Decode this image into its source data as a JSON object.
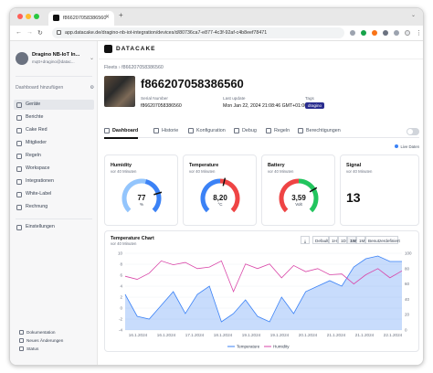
{
  "browser": {
    "tab_title": "f866207058386560",
    "url": "app.datacake.de/dragino-nb-iot-integration/devices/d/80736ca7-e877-4c3f-92af-c4b8eef78471"
  },
  "sidebar": {
    "workspace_name": "Dragino NB-IoT In...",
    "workspace_email": "mqtt+dragino@datac...",
    "add_dashboard": "Dashboard hinzufügen",
    "items": [
      {
        "label": "Geräte"
      },
      {
        "label": "Berichte"
      },
      {
        "label": "Cake Red"
      },
      {
        "label": "Mitglieder"
      },
      {
        "label": "Regeln"
      },
      {
        "label": "Workspace"
      },
      {
        "label": "Integrationen"
      },
      {
        "label": "White-Label"
      },
      {
        "label": "Rechnung"
      },
      {
        "label": "Einstellungen"
      }
    ],
    "footer": [
      {
        "label": "Dokumentation"
      },
      {
        "label": "Neues Änderungen"
      },
      {
        "label": "Status"
      }
    ]
  },
  "header": {
    "brand": "DATACAKE",
    "breadcrumb_root": "Fleets",
    "breadcrumb_current": "f866207058386560",
    "device_title": "f866207058386560",
    "serial_label": "Serial Number",
    "serial_value": "f866207058386560",
    "update_label": "Last update",
    "update_value": "Mon Jan 22, 2024 21:08:46 GMT+01:00",
    "tags_label": "Tags",
    "tag_value": "dragino"
  },
  "tabs": [
    {
      "label": "Dashboard"
    },
    {
      "label": "Historie"
    },
    {
      "label": "Konfiguration"
    },
    {
      "label": "Debug"
    },
    {
      "label": "Regeln"
    },
    {
      "label": "Berechtigungen"
    }
  ],
  "live_label": "Live Daten",
  "widgets": [
    {
      "title": "Humidity",
      "subtitle": "vor 40 Minuten",
      "value": "77",
      "unit": "%",
      "fraction": 0.77,
      "color": "#3b82f6"
    },
    {
      "title": "Temperature",
      "subtitle": "vor 40 Minuten",
      "value": "8,20",
      "unit": "°C",
      "fraction": 0.55,
      "color": "#3b82f6"
    },
    {
      "title": "Battery",
      "subtitle": "vor 40 Minuten",
      "value": "3,59",
      "unit": "Volt",
      "fraction": 0.72,
      "color": "#22c55e"
    },
    {
      "title": "Signal",
      "subtitle": "vor 40 Minuten",
      "value": "13"
    }
  ],
  "chart": {
    "title": "Temperature Chart",
    "subtitle": "vor 40 Minuten",
    "buttons": [
      "Default",
      "1H",
      "1D",
      "1W",
      "1M",
      "Benutzerdefiniert"
    ],
    "selected_button": "1W"
  },
  "chart_data": {
    "type": "area",
    "x": [
      "16.1.2024",
      "16.1.2024",
      "17.1.2024",
      "18.1.2024",
      "19.1.2024",
      "19.1.2024",
      "20.1.2024",
      "21.1.2024",
      "21.1.2024",
      "22.1.2024"
    ],
    "ylim_left": [
      -4,
      10
    ],
    "ylim_right": [
      0,
      100
    ],
    "left_ticks": [
      "10",
      "8",
      "6",
      "4",
      "2",
      "0",
      "-2",
      "-4"
    ],
    "right_ticks": [
      "100",
      "80",
      "60",
      "40",
      "20",
      "0"
    ],
    "series": [
      {
        "name": "Temperature",
        "axis": "left",
        "color": "#3b82f6",
        "values": [
          2.5,
          -1.5,
          -2.0,
          0.5,
          3.0,
          -1.0,
          2.5,
          4.0,
          -2.5,
          -1.0,
          1.5,
          -1.5,
          -2.5,
          2.0,
          -1.0,
          3.0,
          4.0,
          5.0,
          4.0,
          7.5,
          9.0,
          9.5,
          8.5,
          8.5
        ]
      },
      {
        "name": "Humidity",
        "axis": "right",
        "color": "#d946a8",
        "values": [
          70,
          66,
          74,
          90,
          85,
          88,
          80,
          82,
          90,
          50,
          86,
          80,
          86,
          68,
          84,
          76,
          80,
          72,
          73,
          60,
          72,
          80,
          68,
          77
        ]
      }
    ]
  }
}
